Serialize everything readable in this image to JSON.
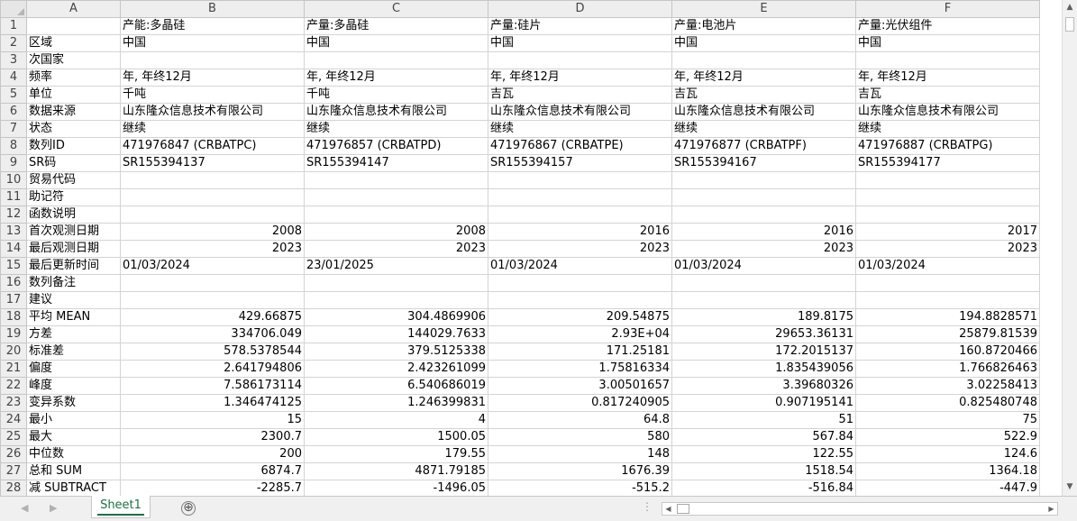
{
  "sheet": {
    "column_letters": [
      "A",
      "B",
      "C",
      "D",
      "E",
      "F"
    ],
    "rows": [
      {
        "n": "1",
        "a": "",
        "cells": [
          "产能:多晶硅",
          "产量:多晶硅",
          "产量:硅片",
          "产量:电池片",
          "产量:光伏组件"
        ],
        "align": "txt"
      },
      {
        "n": "2",
        "a": "区域",
        "cells": [
          "中国",
          "中国",
          "中国",
          "中国",
          "中国"
        ],
        "align": "txt"
      },
      {
        "n": "3",
        "a": "次国家",
        "cells": [
          "",
          "",
          "",
          "",
          ""
        ],
        "align": "txt"
      },
      {
        "n": "4",
        "a": "频率",
        "cells": [
          "年, 年终12月",
          "年, 年终12月",
          "年, 年终12月",
          "年, 年终12月",
          "年, 年终12月"
        ],
        "align": "txt"
      },
      {
        "n": "5",
        "a": "单位",
        "cells": [
          "千吨",
          "千吨",
          "吉瓦",
          "吉瓦",
          "吉瓦"
        ],
        "align": "txt"
      },
      {
        "n": "6",
        "a": "数据来源",
        "cells": [
          "山东隆众信息技术有限公司",
          "山东隆众信息技术有限公司",
          "山东隆众信息技术有限公司",
          "山东隆众信息技术有限公司",
          "山东隆众信息技术有限公司"
        ],
        "align": "txt"
      },
      {
        "n": "7",
        "a": "状态",
        "cells": [
          "继续",
          "继续",
          "继续",
          "继续",
          "继续"
        ],
        "align": "txt"
      },
      {
        "n": "8",
        "a": "数列ID",
        "cells": [
          "471976847 (CRBATPC)",
          "471976857 (CRBATPD)",
          "471976867 (CRBATPE)",
          "471976877 (CRBATPF)",
          "471976887 (CRBATPG)"
        ],
        "align": "txt"
      },
      {
        "n": "9",
        "a": "SR码",
        "cells": [
          "SR155394137",
          "SR155394147",
          "SR155394157",
          "SR155394167",
          "SR155394177"
        ],
        "align": "txt"
      },
      {
        "n": "10",
        "a": "贸易代码",
        "cells": [
          "",
          "",
          "",
          "",
          ""
        ],
        "align": "txt"
      },
      {
        "n": "11",
        "a": "助记符",
        "cells": [
          "",
          "",
          "",
          "",
          ""
        ],
        "align": "txt"
      },
      {
        "n": "12",
        "a": "函数说明",
        "cells": [
          "",
          "",
          "",
          "",
          ""
        ],
        "align": "txt"
      },
      {
        "n": "13",
        "a": "首次观测日期",
        "cells": [
          "2008",
          "2008",
          "2016",
          "2016",
          "2017"
        ],
        "align": "num"
      },
      {
        "n": "14",
        "a": "最后观测日期",
        "cells": [
          "2023",
          "2023",
          "2023",
          "2023",
          "2023"
        ],
        "align": "num"
      },
      {
        "n": "15",
        "a": "最后更新时间",
        "cells": [
          "01/03/2024",
          "23/01/2025",
          "01/03/2024",
          "01/03/2024",
          "01/03/2024"
        ],
        "align": "txt"
      },
      {
        "n": "16",
        "a": "数列备注",
        "cells": [
          "",
          "",
          "",
          "",
          ""
        ],
        "align": "txt"
      },
      {
        "n": "17",
        "a": "建议",
        "cells": [
          "",
          "",
          "",
          "",
          ""
        ],
        "align": "txt"
      },
      {
        "n": "18",
        "a": "平均 MEAN",
        "cells": [
          "429.66875",
          "304.4869906",
          "209.54875",
          "189.8175",
          "194.8828571"
        ],
        "align": "num"
      },
      {
        "n": "19",
        "a": "方差",
        "cells": [
          "334706.049",
          "144029.7633",
          "2.93E+04",
          "29653.36131",
          "25879.81539"
        ],
        "align": "num"
      },
      {
        "n": "20",
        "a": "标准差",
        "cells": [
          "578.5378544",
          "379.5125338",
          "171.25181",
          "172.2015137",
          "160.8720466"
        ],
        "align": "num"
      },
      {
        "n": "21",
        "a": "偏度",
        "cells": [
          "2.641794806",
          "2.423261099",
          "1.75816334",
          "1.835439056",
          "1.766826463"
        ],
        "align": "num"
      },
      {
        "n": "22",
        "a": "峰度",
        "cells": [
          "7.586173114",
          "6.540686019",
          "3.00501657",
          "3.39680326",
          "3.02258413"
        ],
        "align": "num"
      },
      {
        "n": "23",
        "a": "变异系数",
        "cells": [
          "1.346474125",
          "1.246399831",
          "0.817240905",
          "0.907195141",
          "0.825480748"
        ],
        "align": "num"
      },
      {
        "n": "24",
        "a": "最小",
        "cells": [
          "15",
          "4",
          "64.8",
          "51",
          "75"
        ],
        "align": "num"
      },
      {
        "n": "25",
        "a": "最大",
        "cells": [
          "2300.7",
          "1500.05",
          "580",
          "567.84",
          "522.9"
        ],
        "align": "num"
      },
      {
        "n": "26",
        "a": "中位数",
        "cells": [
          "200",
          "179.55",
          "148",
          "122.55",
          "124.6"
        ],
        "align": "num"
      },
      {
        "n": "27",
        "a": "总和 SUM",
        "cells": [
          "6874.7",
          "4871.79185",
          "1676.39",
          "1518.54",
          "1364.18"
        ],
        "align": "num"
      },
      {
        "n": "28",
        "a": "减 SUBTRACT",
        "cells": [
          "-2285.7",
          "-1496.05",
          "-515.2",
          "-516.84",
          "-447.9"
        ],
        "align": "num"
      }
    ]
  },
  "tabs": {
    "active": "Sheet1",
    "add_symbol": "⊕",
    "nav_prev": "◀",
    "nav_next": "▶",
    "dots": "⋮"
  },
  "scrollbars": {
    "up": "▲",
    "down": "▼",
    "left": "◀",
    "right": "▶"
  }
}
